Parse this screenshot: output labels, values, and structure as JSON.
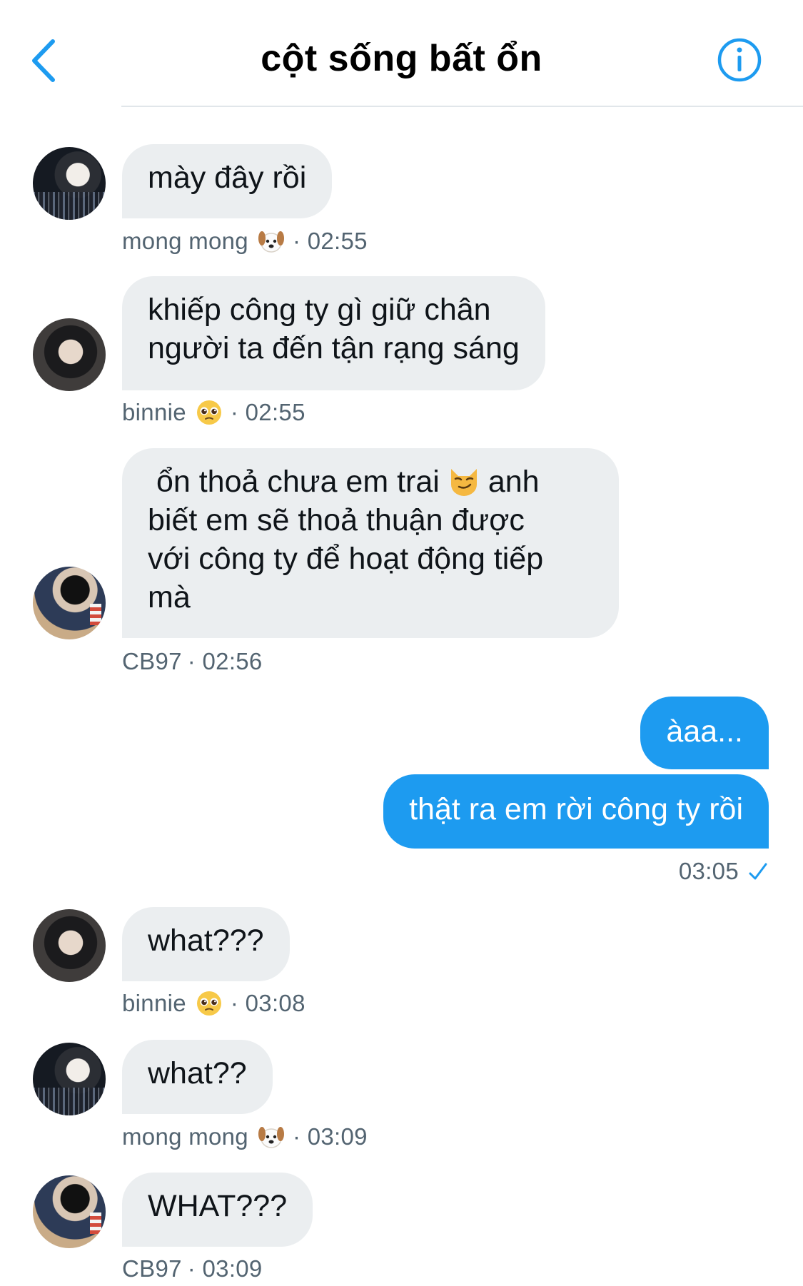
{
  "header": {
    "title": "cột sống bất ổn",
    "back_icon": "chevron-left-icon",
    "info_icon": "info-icon",
    "accent_color": "#1d9bf0"
  },
  "messages": [
    {
      "direction": "in",
      "text": "mày đây rồi",
      "sender": "mong mong",
      "sender_emoji": "dog-face",
      "time": "· 02:55"
    },
    {
      "direction": "in",
      "text": "khiếp công ty gì giữ chân\nngười ta đến tận rạng sáng",
      "sender": "binnie",
      "sender_emoji": "pleading-face",
      "time": "· 02:55"
    },
    {
      "direction": "in",
      "text_before": " ổn thoả chưa em trai",
      "inline_emoji": "smirking-cat",
      "text_after": "anh\nbiết em sẽ thoả thuận được\nvới công ty để hoạt động tiếp\nmà",
      "sender": "CB97",
      "time": "· 02:56"
    },
    {
      "direction": "out",
      "text": "àaa..."
    },
    {
      "direction": "out",
      "text": "thật ra em rời công ty rồi",
      "time": "03:05",
      "status": "sent-check"
    },
    {
      "direction": "in",
      "text": "what???",
      "sender": "binnie",
      "sender_emoji": "pleading-face",
      "time": "· 03:08"
    },
    {
      "direction": "in",
      "text": "what??",
      "sender": "mong mong",
      "sender_emoji": "dog-face",
      "time": "· 03:09"
    },
    {
      "direction": "in",
      "text": "WHAT???",
      "sender": "CB97",
      "time": "· 03:09"
    }
  ]
}
